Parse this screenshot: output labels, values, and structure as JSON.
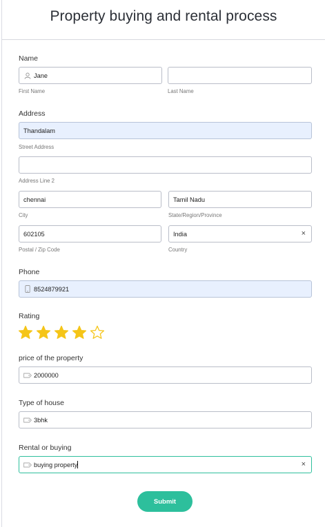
{
  "title": "Property buying and rental process",
  "name": {
    "label": "Name",
    "first": {
      "value": "Jane",
      "sub": "First Name",
      "icon": "user-icon"
    },
    "last": {
      "value": "",
      "sub": "Last Name"
    }
  },
  "address": {
    "label": "Address",
    "street": {
      "value": "Thandalam",
      "sub": "Street Address"
    },
    "line2": {
      "value": "",
      "sub": "Address Line 2"
    },
    "city": {
      "value": "chennai",
      "sub": "City"
    },
    "state": {
      "value": "Tamil Nadu",
      "sub": "State/Region/Province"
    },
    "zip": {
      "value": "602105",
      "sub": "Postal / Zip Code"
    },
    "country": {
      "value": "India",
      "sub": "Country",
      "clear": "×"
    }
  },
  "phone": {
    "label": "Phone",
    "value": "8524879921",
    "icon": "phone-icon"
  },
  "rating": {
    "label": "Rating",
    "value": 4,
    "max": 5,
    "color": "#f5c518"
  },
  "price": {
    "label": "price of the property",
    "value": "2000000",
    "icon": "tag-icon"
  },
  "house": {
    "label": "Type of house",
    "value": "3bhk",
    "icon": "tag-icon"
  },
  "rental": {
    "label": "Rental or buying",
    "value": "buying property",
    "icon": "tag-icon",
    "clear": "×"
  },
  "submit": {
    "label": "Submit",
    "color": "#2dbf9c"
  }
}
